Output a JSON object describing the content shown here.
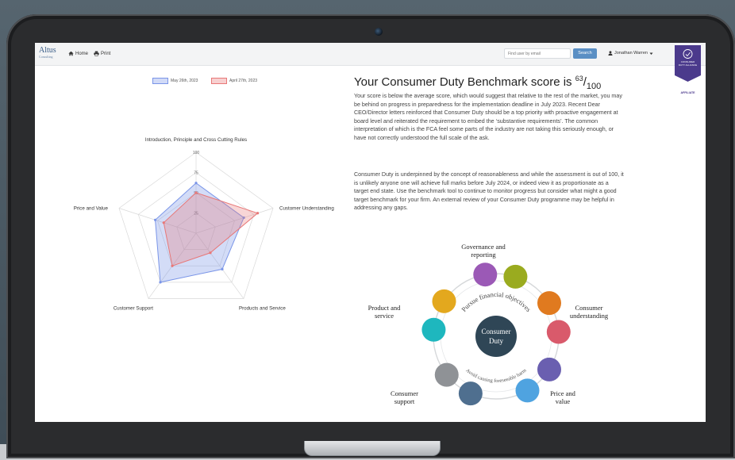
{
  "navbar": {
    "brand": "Altus",
    "brand_sub": "Consulting",
    "home_label": "Home",
    "print_label": "Print",
    "search_placeholder": "Find user by email",
    "search_button": "Search",
    "user_name": "Jonathan Warren"
  },
  "badge": {
    "line1": "CONSUMER",
    "line2": "DUTY ALLIANCE",
    "affiliate": "AFFILIATE"
  },
  "chart_data": {
    "type": "radar",
    "axes": [
      "Introduction, Principle and Cross Cutting Rules",
      "Customer Understanding",
      "Products and Service",
      "Customer Support",
      "Price and Value"
    ],
    "rlim": [
      0,
      100
    ],
    "ticks": [
      "25",
      "50",
      "75",
      "100"
    ],
    "grid": true,
    "legend_position": "top",
    "series": [
      {
        "name": "May 26th, 2023",
        "values": [
          62,
          62,
          55,
          75,
          53
        ],
        "color": "#7a95e8"
      },
      {
        "name": "April 27th, 2023",
        "values": [
          50,
          80,
          30,
          50,
          42
        ],
        "color": "#e87878"
      }
    ]
  },
  "score": {
    "title": "Your Consumer Duty Benchmark score is",
    "value": "63",
    "max": "100"
  },
  "paragraphs": [
    "Your score is below the average score, which would suggest that relative to the rest of the market, you may be behind on progress in preparedness for the implementation deadline in July 2023. Recent Dear CEO/Director letters reinforced that Consumer Duty should be a top priority with proactive engagement at board level and reiterated the requirement to embed the ‘substantive requirements’. The common interpretation of which is the FCA feel some parts of the industry are not taking this seriously enough, or have not correctly understood the full scale of the ask.",
    "Consumer Duty is underpinned by the concept of reasonableness and while the assessment is out of 100, it is unlikely anyone one will achieve full marks before July 2024, or indeed view it as proportionate as a target end state. Use the benchmark tool to continue to monitor progress but consider what might a good target benchmark for your firm. An external review of your Consumer Duty programme may be helpful in addressing any gaps."
  ],
  "diagram": {
    "center": "Consumer Duty",
    "center_line1": "Consumer",
    "center_line2": "Duty",
    "arc_top": "Pursue financial objectives",
    "arc_bottom": "Avoid causing foreseeable harm",
    "labels": {
      "governance": [
        "Governance and",
        "reporting"
      ],
      "consumer_understanding": [
        "Consumer",
        "understanding"
      ],
      "price_value": [
        "Price and",
        "value"
      ],
      "consumer_support": [
        "Consumer",
        "support"
      ],
      "product_service": [
        "Product and",
        "service"
      ]
    },
    "colors": [
      "#9b59b6",
      "#9aab1f",
      "#e07a1f",
      "#d95a6b",
      "#6a5fb0",
      "#4fa3e0",
      "#4f6f8f",
      "#8f9296",
      "#1eb7be",
      "#e3a81e"
    ]
  }
}
